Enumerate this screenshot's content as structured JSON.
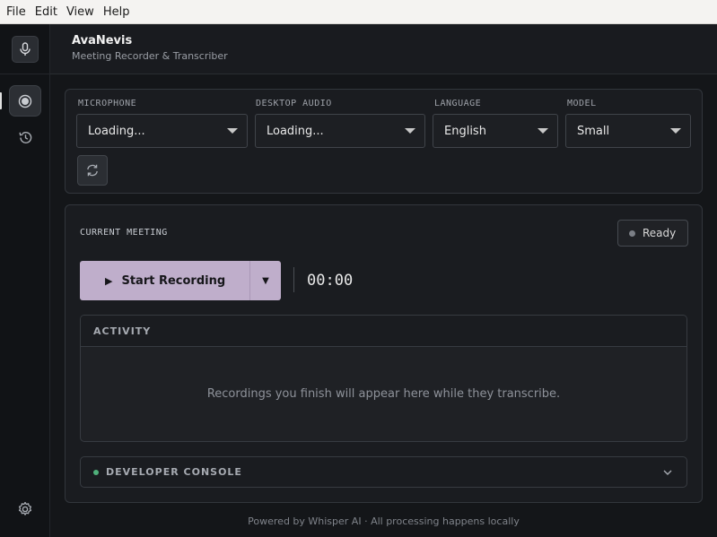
{
  "menubar": {
    "items": [
      "File",
      "Edit",
      "View",
      "Help"
    ]
  },
  "sidebar": {
    "logo_icon": "microphone-icon",
    "nav": [
      {
        "name": "record",
        "icon": "record-icon",
        "active": true
      },
      {
        "name": "history",
        "icon": "history-icon",
        "active": false
      }
    ],
    "bottom_icon": "gear-icon"
  },
  "header": {
    "title": "AvaNevis",
    "subtitle": "Meeting Recorder & Transcriber"
  },
  "settings": {
    "microphone": {
      "label": "MICROPHONE",
      "value": "Loading..."
    },
    "desktop_audio": {
      "label": "DESKTOP AUDIO",
      "value": "Loading..."
    },
    "language": {
      "label": "LANGUAGE",
      "value": "English"
    },
    "model": {
      "label": "MODEL",
      "value": "Small"
    },
    "refresh_icon": "refresh-icon"
  },
  "meeting": {
    "title": "CURRENT MEETING",
    "status": "Ready",
    "record_label": "Start Recording",
    "play_glyph": "▶",
    "dropdown_glyph": "▼",
    "timer": "00:00",
    "activity": {
      "title": "ACTIVITY",
      "empty_text": "Recordings you finish will appear here while they transcribe."
    },
    "console": {
      "label": "DEVELOPER CONSOLE"
    }
  },
  "footer": {
    "text": "Powered by Whisper AI · All processing happens locally"
  },
  "colors": {
    "accent": "#bfaecb",
    "background": "#141619",
    "card": "#1a1c20",
    "status_dot": "#7b7f86",
    "console_dot": "#4fb07a"
  }
}
